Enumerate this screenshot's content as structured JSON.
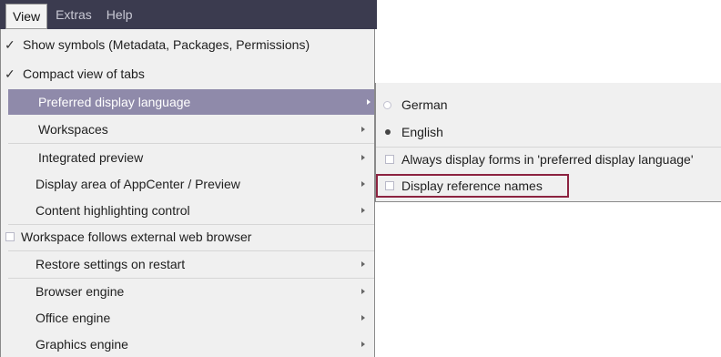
{
  "menubar": {
    "items": [
      {
        "label": "View",
        "active": true
      },
      {
        "label": "Extras",
        "active": false
      },
      {
        "label": "Help",
        "active": false
      }
    ]
  },
  "view_menu": {
    "items": [
      {
        "label": "Show symbols (Metadata, Packages, Permissions)",
        "kind": "checked"
      },
      {
        "label": "Compact view of tabs",
        "kind": "checked"
      },
      {
        "label": "Preferred display language",
        "kind": "submenu",
        "highlighted": true
      },
      {
        "label": "Workspaces",
        "kind": "submenu"
      },
      {
        "label": "Integrated preview",
        "kind": "submenu"
      },
      {
        "label": "Display area of AppCenter / Preview",
        "kind": "submenu"
      },
      {
        "label": "Content highlighting control",
        "kind": "submenu"
      },
      {
        "label": "Workspace follows external web browser",
        "kind": "checkbox"
      },
      {
        "label": "Restore settings on restart",
        "kind": "submenu"
      },
      {
        "label": "Browser engine",
        "kind": "submenu"
      },
      {
        "label": "Office engine",
        "kind": "submenu"
      },
      {
        "label": "Graphics engine",
        "kind": "submenu"
      }
    ]
  },
  "language_submenu": {
    "items": [
      {
        "label": "German",
        "kind": "radio",
        "selected": false
      },
      {
        "label": "English",
        "kind": "radio",
        "selected": true
      },
      {
        "label": "Always display forms in 'preferred display language'",
        "kind": "checkbox"
      },
      {
        "label": "Display reference names",
        "kind": "checkbox",
        "focused": true
      }
    ]
  },
  "colors": {
    "menubar_bg": "#3b3b4f",
    "highlight_bg": "#8f8aaa",
    "focus_border": "#8c2340",
    "menu_bg": "#f0f0f0"
  }
}
